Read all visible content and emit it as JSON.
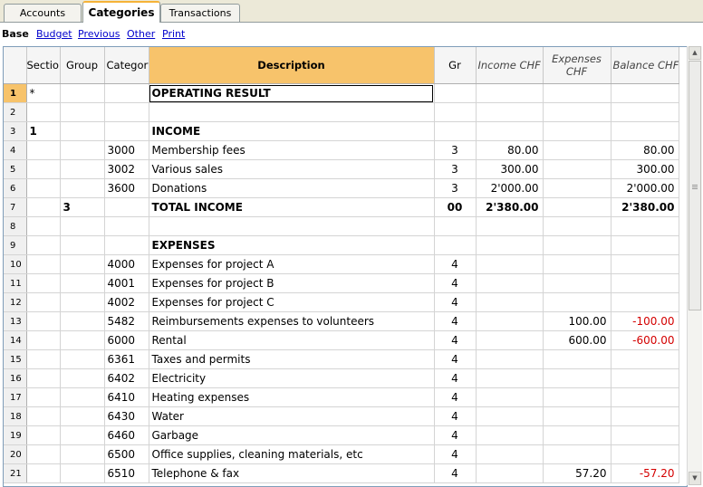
{
  "tabs": [
    {
      "label": "Accounts",
      "active": false
    },
    {
      "label": "Categories",
      "active": true
    },
    {
      "label": "Transactions",
      "active": false
    }
  ],
  "views": {
    "current": "Base",
    "links": [
      "Budget",
      "Previous",
      "Other",
      "Print"
    ]
  },
  "columns": {
    "section": "Sectior",
    "group": "Group",
    "category": "Category",
    "description": "Description",
    "gr": "Gr",
    "income": "Income CHF",
    "expenses": "Expenses CHF",
    "balance": "Balance CHF"
  },
  "rows": [
    {
      "n": "1",
      "section": "*",
      "group": "",
      "category": "",
      "description": "OPERATING RESULT",
      "gr": "",
      "income": "",
      "expenses": "",
      "balance": "",
      "bold": true
    },
    {
      "n": "2",
      "section": "",
      "group": "",
      "category": "",
      "description": "",
      "gr": "",
      "income": "",
      "expenses": "",
      "balance": ""
    },
    {
      "n": "3",
      "section": "1",
      "group": "",
      "category": "",
      "description": "INCOME",
      "gr": "",
      "income": "",
      "expenses": "",
      "balance": "",
      "bold": true
    },
    {
      "n": "4",
      "section": "",
      "group": "",
      "category": "3000",
      "description": "Membership fees",
      "gr": "3",
      "income": "80.00",
      "expenses": "",
      "balance": "80.00"
    },
    {
      "n": "5",
      "section": "",
      "group": "",
      "category": "3002",
      "description": "Various sales",
      "gr": "3",
      "income": "300.00",
      "expenses": "",
      "balance": "300.00"
    },
    {
      "n": "6",
      "section": "",
      "group": "",
      "category": "3600",
      "description": "Donations",
      "gr": "3",
      "income": "2'000.00",
      "expenses": "",
      "balance": "2'000.00"
    },
    {
      "n": "7",
      "section": "",
      "group": "3",
      "category": "",
      "description": "TOTAL INCOME",
      "gr": "00",
      "income": "2'380.00",
      "expenses": "",
      "balance": "2'380.00",
      "bold": true
    },
    {
      "n": "8",
      "section": "",
      "group": "",
      "category": "",
      "description": "",
      "gr": "",
      "income": "",
      "expenses": "",
      "balance": ""
    },
    {
      "n": "9",
      "section": "",
      "group": "",
      "category": "",
      "description": "EXPENSES",
      "gr": "",
      "income": "",
      "expenses": "",
      "balance": "",
      "bold": true
    },
    {
      "n": "10",
      "section": "",
      "group": "",
      "category": "4000",
      "description": "Expenses for project A",
      "gr": "4",
      "income": "",
      "expenses": "",
      "balance": ""
    },
    {
      "n": "11",
      "section": "",
      "group": "",
      "category": "4001",
      "description": "Expenses for project B",
      "gr": "4",
      "income": "",
      "expenses": "",
      "balance": ""
    },
    {
      "n": "12",
      "section": "",
      "group": "",
      "category": "4002",
      "description": "Expenses for project C",
      "gr": "4",
      "income": "",
      "expenses": "",
      "balance": ""
    },
    {
      "n": "13",
      "section": "",
      "group": "",
      "category": "5482",
      "description": "Reimbursements expenses to volunteers",
      "gr": "4",
      "income": "",
      "expenses": "100.00",
      "balance": "-100.00",
      "negative": true
    },
    {
      "n": "14",
      "section": "",
      "group": "",
      "category": "6000",
      "description": "Rental",
      "gr": "4",
      "income": "",
      "expenses": "600.00",
      "balance": "-600.00",
      "negative": true
    },
    {
      "n": "15",
      "section": "",
      "group": "",
      "category": "6361",
      "description": "Taxes and permits",
      "gr": "4",
      "income": "",
      "expenses": "",
      "balance": ""
    },
    {
      "n": "16",
      "section": "",
      "group": "",
      "category": "6402",
      "description": "Electricity",
      "gr": "4",
      "income": "",
      "expenses": "",
      "balance": ""
    },
    {
      "n": "17",
      "section": "",
      "group": "",
      "category": "6410",
      "description": "Heating expenses",
      "gr": "4",
      "income": "",
      "expenses": "",
      "balance": ""
    },
    {
      "n": "18",
      "section": "",
      "group": "",
      "category": "6430",
      "description": "Water",
      "gr": "4",
      "income": "",
      "expenses": "",
      "balance": ""
    },
    {
      "n": "19",
      "section": "",
      "group": "",
      "category": "6460",
      "description": "Garbage",
      "gr": "4",
      "income": "",
      "expenses": "",
      "balance": ""
    },
    {
      "n": "20",
      "section": "",
      "group": "",
      "category": "6500",
      "description": "Office supplies, cleaning materials, etc",
      "gr": "4",
      "income": "",
      "expenses": "",
      "balance": ""
    },
    {
      "n": "21",
      "section": "",
      "group": "",
      "category": "6510",
      "description": "Telephone & fax",
      "gr": "4",
      "income": "",
      "expenses": "57.20",
      "balance": "-57.20",
      "negative": true
    }
  ],
  "colors": {
    "active_header": "#f7c36b",
    "negative": "#d40000",
    "link": "#0000cc"
  }
}
